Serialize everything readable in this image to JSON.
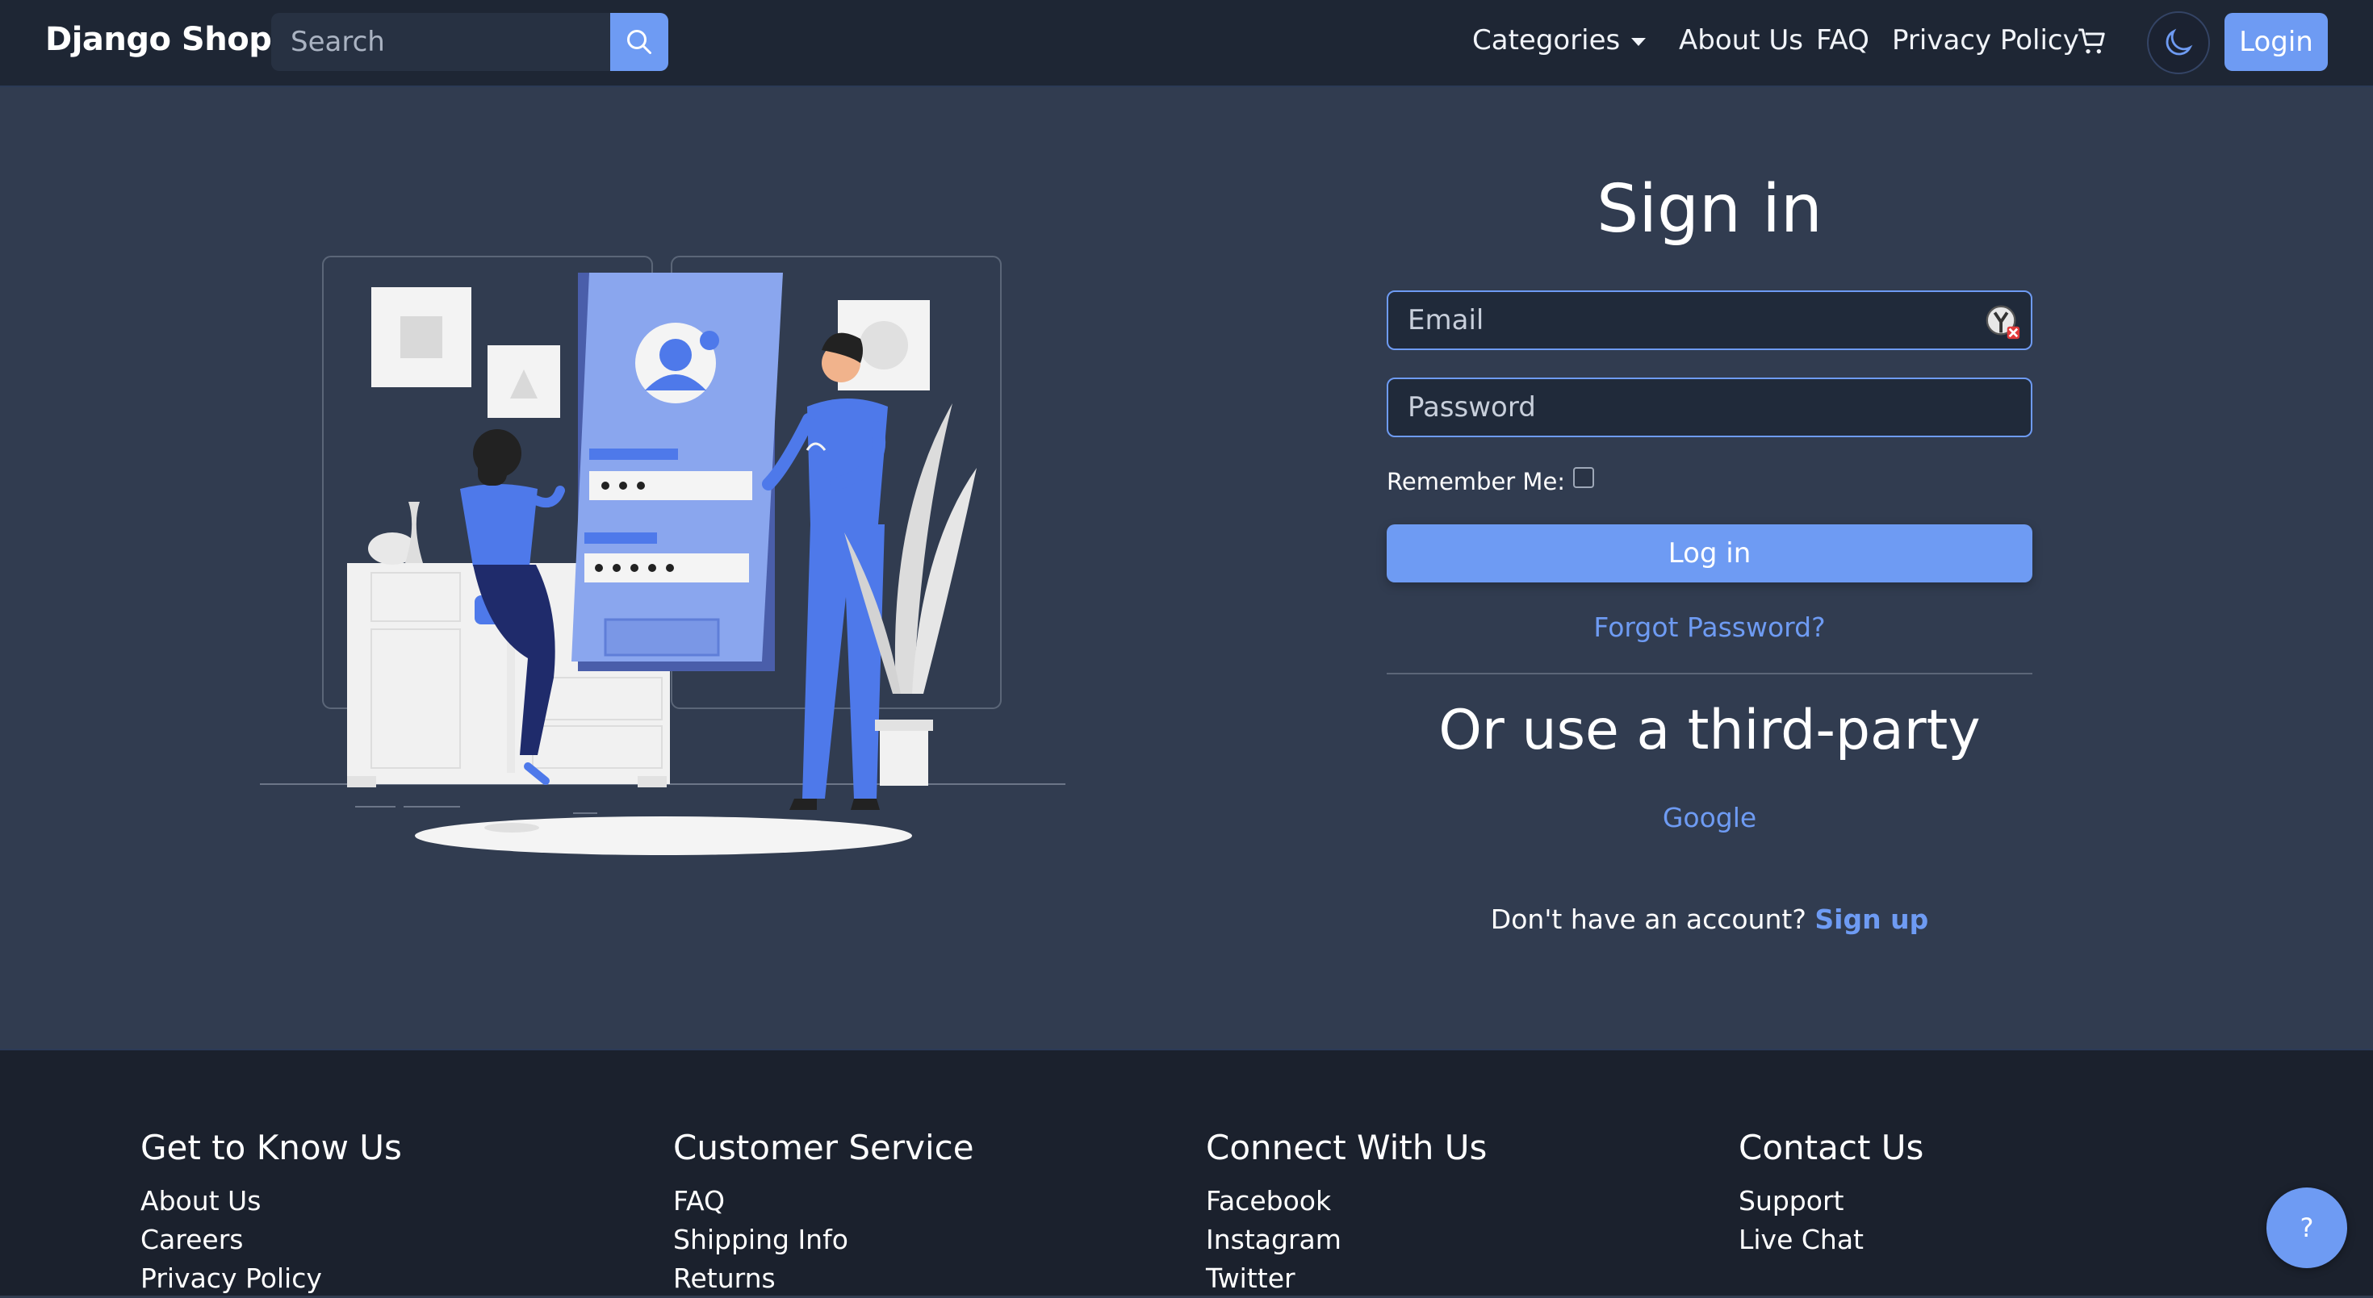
{
  "navbar": {
    "brand": "Django Shop",
    "search_placeholder": "Search",
    "categories": "Categories",
    "about": "About Us",
    "faq": "FAQ",
    "privacy": "Privacy Policy",
    "login": "Login",
    "icons": [
      "search-icon",
      "cart-icon",
      "moon-icon"
    ]
  },
  "signin": {
    "title": "Sign in",
    "email_placeholder": "Email",
    "password_placeholder": "Password",
    "remember_label": "Remember Me:",
    "remember_checked": false,
    "submit": "Log in",
    "forgot": "Forgot Password?",
    "third_party_title": "Or use a third-party",
    "google": "Google",
    "no_account": "Don't have an account?",
    "signup": "Sign up"
  },
  "footer": {
    "columns": [
      {
        "title": "Get to Know Us",
        "links": [
          "About Us",
          "Careers",
          "Privacy Policy"
        ]
      },
      {
        "title": "Customer Service",
        "links": [
          "FAQ",
          "Shipping Info",
          "Returns"
        ]
      },
      {
        "title": "Connect With Us",
        "links": [
          "Facebook",
          "Instagram",
          "Twitter"
        ]
      },
      {
        "title": "Contact Us",
        "links": [
          "Support",
          "Live Chat"
        ]
      }
    ]
  },
  "help_button": "?",
  "colors": {
    "accent": "#6e9bf3",
    "navbar_bg": "#1e2634",
    "page_bg": "#313c50",
    "footer_bg": "#1b212d"
  }
}
